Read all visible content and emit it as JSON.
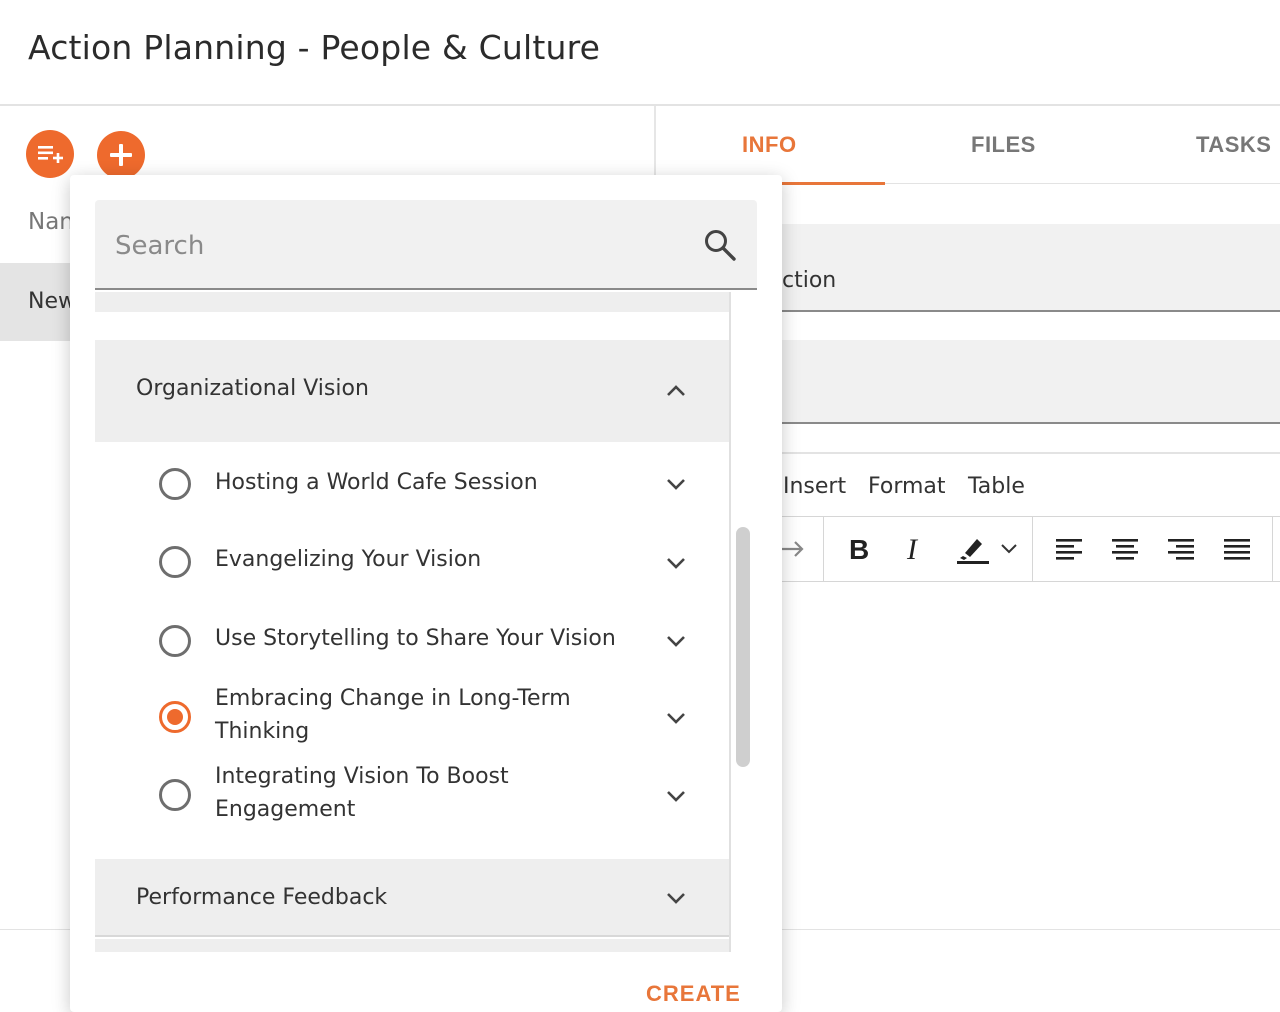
{
  "page": {
    "title": "Action Planning - People & Culture"
  },
  "left_panel": {
    "name_column_header": "Nan",
    "new_row_label": "New",
    "add_list_icon": "playlist-add-icon",
    "add_icon": "plus-icon"
  },
  "right_panel": {
    "tabs": [
      {
        "label": "INFO",
        "active": true
      },
      {
        "label": "FILES",
        "active": false
      },
      {
        "label": "TASKS",
        "active": false
      }
    ],
    "field1_value": "ction",
    "editor": {
      "menu": [
        "Insert",
        "Format",
        "Table"
      ],
      "toolbar_icons": [
        "redo-icon",
        "bold-icon",
        "italic-icon",
        "highlight-icon",
        "chevron-down-icon",
        "align-left-icon",
        "align-center-icon",
        "align-right-icon",
        "align-justify-icon"
      ]
    }
  },
  "dropdown": {
    "search": {
      "placeholder": "Search",
      "value": ""
    },
    "groups": [
      {
        "label": "Organizational Vision",
        "expanded": true,
        "items": [
          {
            "label": "Hosting a World Cafe Session",
            "selected": false
          },
          {
            "label": "Evangelizing Your Vision",
            "selected": false
          },
          {
            "label": "Use Storytelling to Share Your Vision",
            "selected": false
          },
          {
            "label": "Embracing Change in Long-Term Thinking",
            "selected": true
          },
          {
            "label": "Integrating Vision To Boost Engagement",
            "selected": false
          }
        ]
      },
      {
        "label": "Performance Feedback",
        "expanded": false,
        "items": []
      }
    ],
    "create_label": "CREATE"
  },
  "colors": {
    "accent": "#ee6a2d",
    "tab_active": "#e8763a",
    "panel_bg": "#eeeeee"
  }
}
